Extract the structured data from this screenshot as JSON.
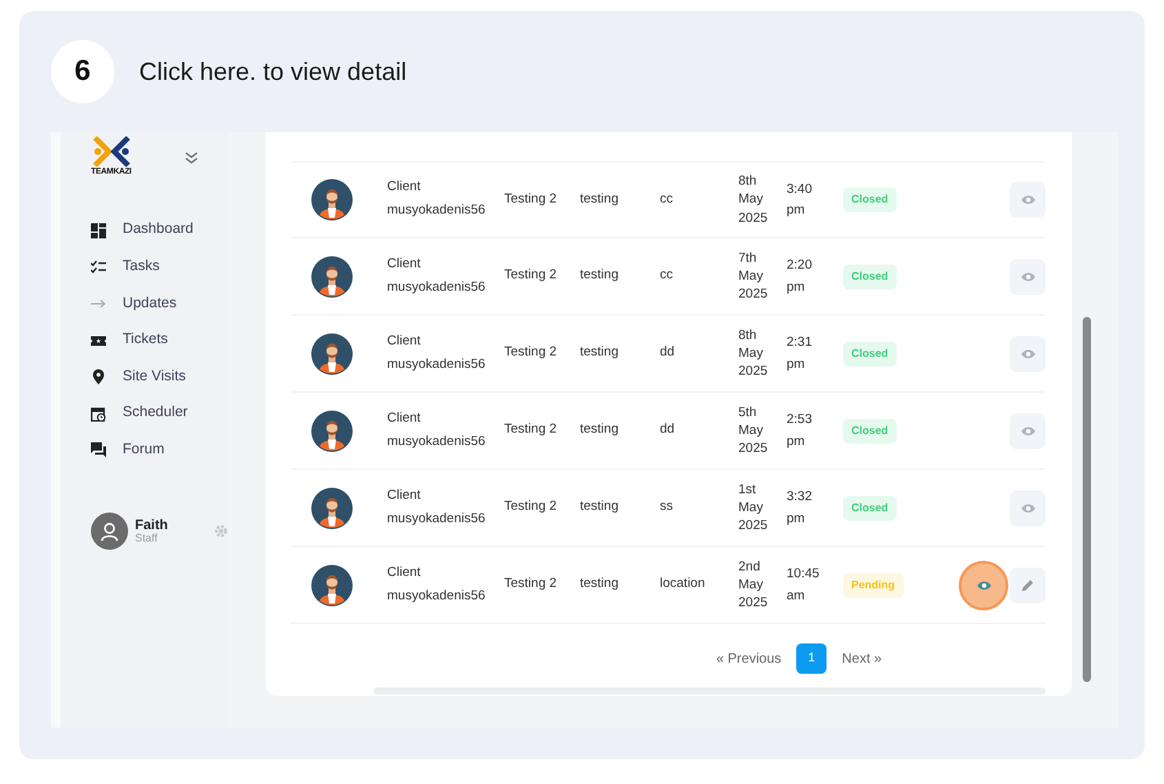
{
  "step": {
    "number": "6",
    "instruction": "Click here. to view detail"
  },
  "sidebar": {
    "logo_text": "TEAMKAZI",
    "items": [
      {
        "label": "Dashboard"
      },
      {
        "label": "Tasks"
      },
      {
        "label": "Updates"
      },
      {
        "label": "Tickets"
      },
      {
        "label": "Site Visits"
      },
      {
        "label": "Scheduler"
      },
      {
        "label": "Forum"
      }
    ],
    "user": {
      "name": "Faith",
      "role": "Staff"
    }
  },
  "table": {
    "rows": [
      {
        "client": "Client",
        "email": "musyokadenis56",
        "subject": "Testing 2",
        "category": "testing",
        "location": "cc",
        "date": "8th May 2025",
        "time": "3:40 pm",
        "status": {
          "label": "Closed",
          "color": "#3ecf7a"
        },
        "editable": false,
        "highlighted": false
      },
      {
        "client": "Client",
        "email": "musyokadenis56",
        "subject": "Testing 2",
        "category": "testing",
        "location": "cc",
        "date": "7th May 2025",
        "time": "2:20 pm",
        "status": {
          "label": "Closed",
          "color": "#3ecf7a"
        },
        "editable": false,
        "highlighted": false
      },
      {
        "client": "Client",
        "email": "musyokadenis56",
        "subject": "Testing 2",
        "category": "testing",
        "location": "dd",
        "date": "8th May 2025",
        "time": "2:31 pm",
        "status": {
          "label": "Closed",
          "color": "#3ecf7a"
        },
        "editable": false,
        "highlighted": false
      },
      {
        "client": "Client",
        "email": "musyokadenis56",
        "subject": "Testing 2",
        "category": "testing",
        "location": "dd",
        "date": "5th May 2025",
        "time": "2:53 pm",
        "status": {
          "label": "Closed",
          "color": "#3ecf7a"
        },
        "editable": false,
        "highlighted": false
      },
      {
        "client": "Client",
        "email": "musyokadenis56",
        "subject": "Testing 2",
        "category": "testing",
        "location": "ss",
        "date": "1st May 2025",
        "time": "3:32 pm",
        "status": {
          "label": "Closed",
          "color": "#3ecf7a"
        },
        "editable": false,
        "highlighted": false
      },
      {
        "client": "Client",
        "email": "musyokadenis56",
        "subject": "Testing 2",
        "category": "testing",
        "location": "location",
        "date": "2nd May 2025",
        "time": "10:45 am",
        "status": {
          "label": "Pending",
          "color": "#f5c518"
        },
        "editable": true,
        "highlighted": true
      }
    ]
  },
  "pagination": {
    "previous": "« Previous",
    "pages": [
      {
        "label": "1",
        "selected": true
      }
    ],
    "next": "Next »"
  }
}
